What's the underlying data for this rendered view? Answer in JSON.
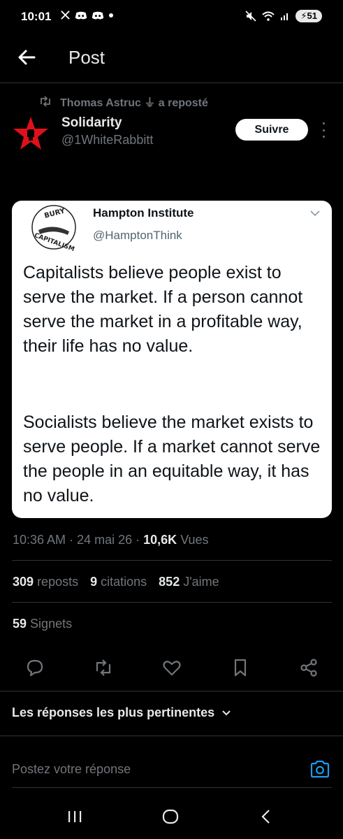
{
  "status_bar": {
    "time": "10:01",
    "left_icons": [
      "x-logo-icon",
      "discord-icon",
      "discord-icon",
      "dot-icon"
    ],
    "battery": "51"
  },
  "header": {
    "title": "Post"
  },
  "post": {
    "reposted_by": "Thomas Astruc ⏚ a reposté",
    "author_name": "Solidarity",
    "author_handle": "@1WhiteRabbitt",
    "follow_label": "Suivre"
  },
  "embedded_tweet": {
    "name": "Hampton Institute",
    "handle": "@HamptonThink",
    "logo_text_top": "BURY",
    "logo_text_bottom": "CAPITALISM",
    "paragraph_1": "Capitalists believe people exist to serve the market. If a person cannot serve the market in a profitable way, their life has no value.",
    "paragraph_2": "Socialists believe the market exists to serve people. If a market cannot serve the people in an equitable way, it has no value."
  },
  "meta": {
    "time": "10:36 AM",
    "date": "24 mai 26",
    "views_count": "10,6K",
    "views_label": "Vues"
  },
  "stats": {
    "reposts_count": "309",
    "reposts_label": "reposts",
    "quotes_count": "9",
    "quotes_label": "citations",
    "likes_count": "852",
    "likes_label": "J'aime",
    "bookmarks_count": "59",
    "bookmarks_label": "Signets"
  },
  "actions": [
    "reply-icon",
    "repost-icon",
    "like-icon",
    "bookmark-icon",
    "share-icon"
  ],
  "replies": {
    "sort_label": "Les réponses les plus pertinentes",
    "input_placeholder": "Postez votre réponse"
  },
  "colors": {
    "background": "#000000",
    "text": "#e7e9ea",
    "muted": "#71767b",
    "accent": "#1d9bf0",
    "avatar_red": "#e0101a"
  }
}
